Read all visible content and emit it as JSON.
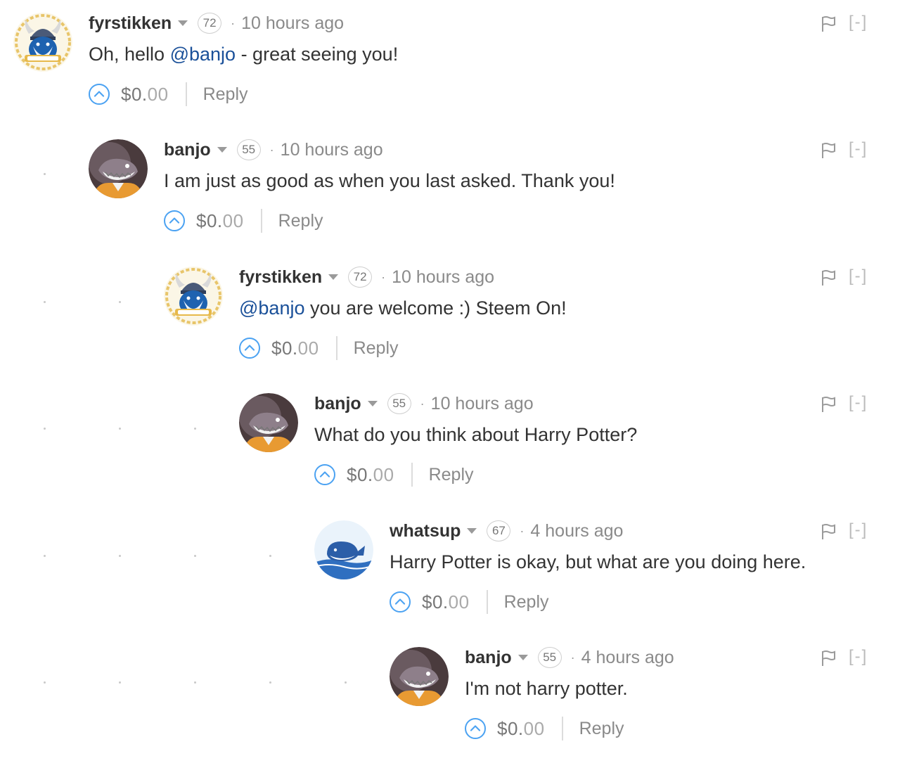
{
  "colors": {
    "mention": "#1a5099",
    "vote": "#4ba2f2",
    "muted": "#8a8a8a"
  },
  "comments": [
    {
      "author": "fyrstikken",
      "reputation": "72",
      "time": "10 hours ago",
      "body_pre": "Oh, hello ",
      "mention": "@banjo",
      "body_post": " - great seeing you!",
      "payout": "$0.",
      "payout_cents": "00",
      "reply_label": "Reply",
      "collapse_label": "[-]",
      "avatar_icon": "viking-avatar-icon",
      "avatar_badge": "@fyrstikken"
    },
    {
      "author": "banjo",
      "reputation": "55",
      "time": "10 hours ago",
      "body_pre": "I am just as good as when you last asked. Thank you!",
      "mention": "",
      "body_post": "",
      "payout": "$0.",
      "payout_cents": "00",
      "reply_label": "Reply",
      "collapse_label": "[-]",
      "avatar_icon": "shark-cartoon-avatar-icon"
    },
    {
      "author": "fyrstikken",
      "reputation": "72",
      "time": "10 hours ago",
      "body_pre": "",
      "mention": "@banjo",
      "body_post": " you are welcome :) Steem On!",
      "payout": "$0.",
      "payout_cents": "00",
      "reply_label": "Reply",
      "collapse_label": "[-]",
      "avatar_icon": "viking-avatar-icon",
      "avatar_badge": "@fyrstikken"
    },
    {
      "author": "banjo",
      "reputation": "55",
      "time": "10 hours ago",
      "body_pre": "What do you think about Harry Potter?",
      "mention": "",
      "body_post": "",
      "payout": "$0.",
      "payout_cents": "00",
      "reply_label": "Reply",
      "collapse_label": "[-]",
      "avatar_icon": "shark-cartoon-avatar-icon"
    },
    {
      "author": "whatsup",
      "reputation": "67",
      "time": "4 hours ago",
      "body_pre": "Harry Potter is okay, but what are you doing here.",
      "mention": "",
      "body_post": "",
      "payout": "$0.",
      "payout_cents": "00",
      "reply_label": "Reply",
      "collapse_label": "[-]",
      "avatar_icon": "whale-avatar-icon"
    },
    {
      "author": "banjo",
      "reputation": "55",
      "time": "4 hours ago",
      "body_pre": "I'm not harry potter.",
      "mention": "",
      "body_post": "",
      "payout": "$0.",
      "payout_cents": "00",
      "reply_label": "Reply",
      "collapse_label": "[-]",
      "avatar_icon": "shark-cartoon-avatar-icon"
    }
  ]
}
